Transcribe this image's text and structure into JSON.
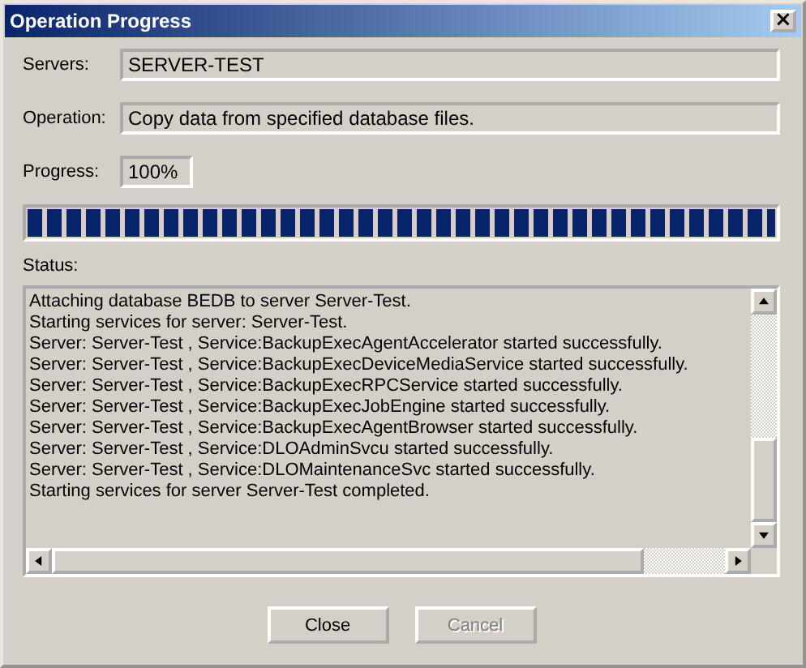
{
  "window": {
    "title": "Operation Progress",
    "close": "×"
  },
  "fields": [
    {
      "label": "Servers:",
      "value": "SERVER-TEST"
    },
    {
      "label": "Operation:",
      "value": "Copy data from specified database files."
    }
  ],
  "progress": {
    "label": "Progress:",
    "reading": "100%",
    "level": 1
  },
  "status": {
    "label": "Status:",
    "lines": [
      "Attaching database BEDB to server Server-Test.",
      "Starting services for server: Server-Test.",
      "Server: Server-Test , Service:BackupExecAgentAccelerator started successfully.",
      "Server: Server-Test , Service:BackupExecDeviceMediaService started successfully.",
      "Server: Server-Test , Service:BackupExecRPCService started successfully.",
      "Server: Server-Test , Service:BackupExecJobEngine started successfully.",
      "Server: Server-Test , Service:BackupExecAgentBrowser started successfully.",
      "Server: Server-Test , Service:DLOAdminSvcu started successfully.",
      "Server: Server-Test , Service:DLOMaintenanceSvc started successfully.",
      "Starting services for server Server-Test  completed."
    ]
  },
  "buttons": [
    {
      "label": "Close",
      "disabled": false
    },
    {
      "label": "Cancel",
      "disabled": true
    }
  ]
}
